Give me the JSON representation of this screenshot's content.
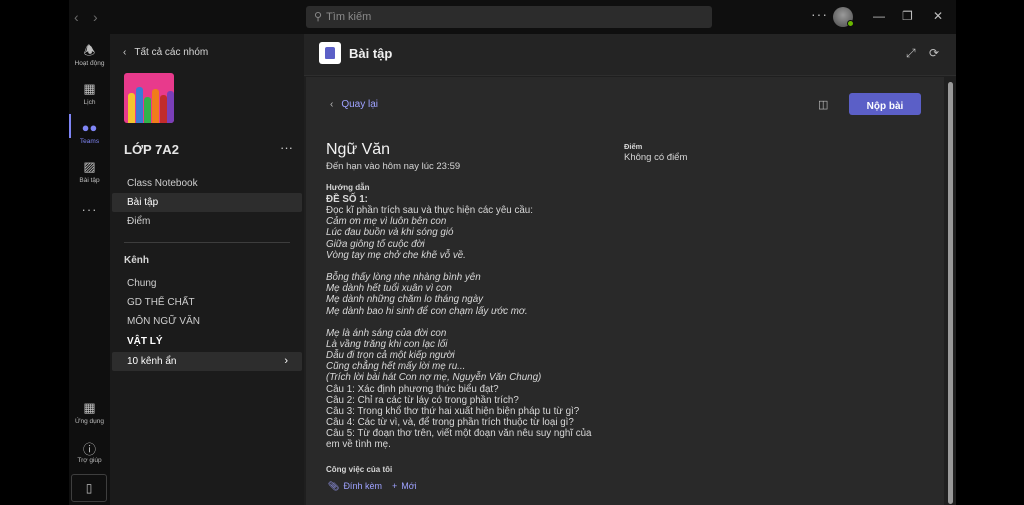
{
  "titlebar": {
    "search_placeholder": "Tìm kiếm",
    "more": "···",
    "minimize": "—",
    "maximize": "❐",
    "close": "✕"
  },
  "rail": {
    "items": [
      {
        "label": "Hoạt động",
        "icon": "bell-icon"
      },
      {
        "label": "Lịch",
        "icon": "calendar-icon"
      },
      {
        "label": "Teams",
        "icon": "teams-icon"
      },
      {
        "label": "Bài tập",
        "icon": "assignments-icon"
      }
    ],
    "more": "···",
    "apps_label": "Ứng dụng",
    "help_label": "Trợ giúp"
  },
  "panel": {
    "back_label": "Tất cả các nhóm",
    "team_name": "LỚP 7A2",
    "team_more": "···",
    "tabs": [
      "Class Notebook",
      "Bài tập",
      "Điểm"
    ],
    "channels_title": "Kênh",
    "channels": [
      "Chung",
      "GD THỂ CHẤT",
      "MÔN NGỮ VĂN",
      "VẬT LÝ"
    ],
    "hidden_channels": "10 kênh ẩn"
  },
  "main": {
    "app_title": "Bài tập",
    "back_label": "Quay lại",
    "submit_label": "Nộp bài",
    "assignment_title": "Ngữ Văn",
    "due": "Đến hạn vào hôm nay lúc 23:59",
    "grade_label": "Điểm",
    "grade_value": "Không có điểm",
    "instructions_label": "Hướng dẫn",
    "lines": [
      {
        "t": "ĐỀ SỐ 1:",
        "s": "b"
      },
      {
        "t": "Đọc kĩ phần trích sau và thực hiện các yêu cầu:",
        "s": ""
      },
      {
        "t": "Cảm ơn mẹ vì luôn bên con",
        "s": "i"
      },
      {
        "t": "Lúc đau buồn và khi sóng gió",
        "s": "i"
      },
      {
        "t": "Giữa giông tố cuộc đời",
        "s": "i"
      },
      {
        "t": "Vòng tay mẹ chở che khẽ vỗ về.",
        "s": "i"
      },
      {
        "t": "",
        "s": "gap"
      },
      {
        "t": "Bỗng thấy lòng nhẹ nhàng bình yên",
        "s": "i"
      },
      {
        "t": "Mẹ dành hết tuổi xuân vì con",
        "s": "i"
      },
      {
        "t": "Mẹ dành những chăm lo tháng ngày",
        "s": "i"
      },
      {
        "t": "Mẹ dành bao hi sinh để con chạm lấy ước mơ.",
        "s": "i"
      },
      {
        "t": "",
        "s": "gap"
      },
      {
        "t": "Mẹ là ánh sáng của đời con",
        "s": "i"
      },
      {
        "t": "Là vầng trăng khi con lạc lối",
        "s": "i"
      },
      {
        "t": "Dẫu đi trọn cả một kiếp người",
        "s": "i"
      },
      {
        "t": "Cũng chẳng hết mấy lời mẹ ru...",
        "s": "i"
      },
      {
        "t": "(Trích lời bài hát Con nợ mẹ, Nguyễn Văn Chung)",
        "s": "i"
      },
      {
        "t": "Câu 1: Xác định phương thức biểu đạt?",
        "s": ""
      },
      {
        "t": "Câu 2: Chỉ ra các từ láy có trong phần trích?",
        "s": ""
      },
      {
        "t": "Câu 3: Trong khổ thơ thứ hai xuất hiện biện pháp tu từ gì?",
        "s": ""
      },
      {
        "t": "Câu 4: Các từ vì, và, để trong phần trích thuộc từ loại gì?",
        "s": ""
      },
      {
        "t": "Câu 5: Từ đoạn thơ trên, viết một đoạn văn nêu suy nghĩ của",
        "s": ""
      },
      {
        "t": "em về tình mẹ.",
        "s": ""
      }
    ],
    "my_work_label": "Công việc của tôi",
    "attach_label": "Đính kèm",
    "new_label": "Mới"
  }
}
